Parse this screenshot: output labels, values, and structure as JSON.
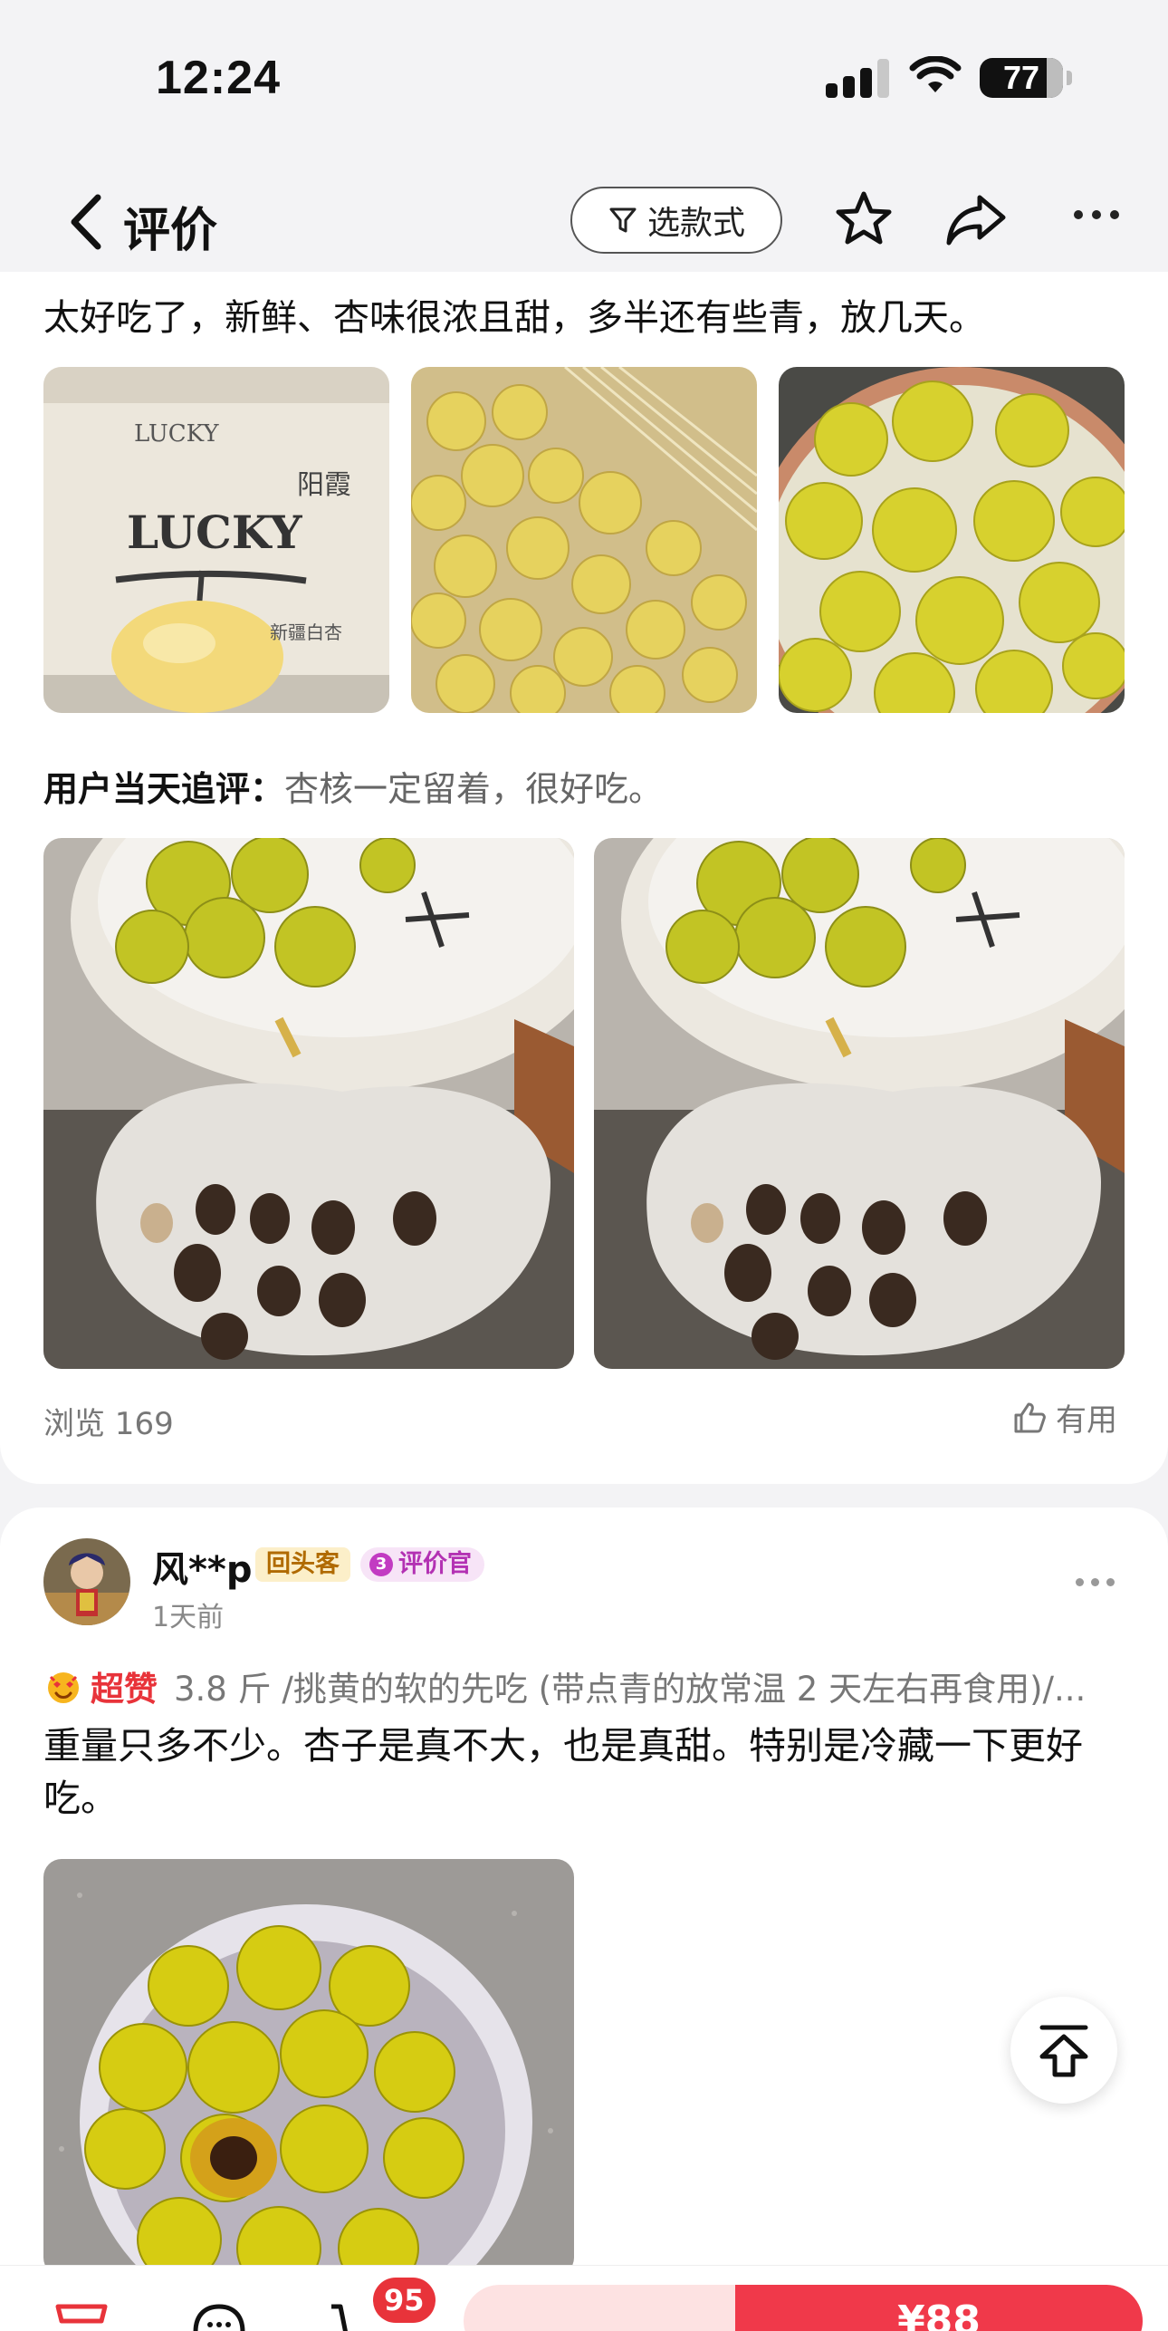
{
  "status_bar": {
    "time": "12:24",
    "battery": "77"
  },
  "nav": {
    "title": "评价",
    "filter_label": "选款式"
  },
  "review1": {
    "text": "太好吃了，新鲜、杏味很浓且甜，多半还有些青，放几天。",
    "box_logo": "LUCKY",
    "box_logo_small": "LUCKY",
    "box_brand": "阳霞",
    "box_product": "新疆白杏",
    "followup_label": "用户当天追评：",
    "followup_text": "杏核一定留着，很好吃。",
    "views": "浏览 169",
    "useful": "有用"
  },
  "review2": {
    "username": "风**p",
    "badge_return": "回头客",
    "badge_reviewer_level": "3",
    "badge_reviewer": "评价官",
    "time": "1天前",
    "rating_level": "超赞",
    "spec": "3.8 斤 /挑黄的软的先吃 (带点青的放常温 2 天左右再食用)/...",
    "text": "重量只多不少。杏子是真不大，也是真甜。特别是冷藏一下更好吃。"
  },
  "bottom_bar": {
    "cart_count": "95",
    "buy_price": "¥88"
  },
  "colors": {
    "accent": "#f0394a",
    "badge_gold": "#b06a00",
    "badge_purple": "#b331b3"
  }
}
